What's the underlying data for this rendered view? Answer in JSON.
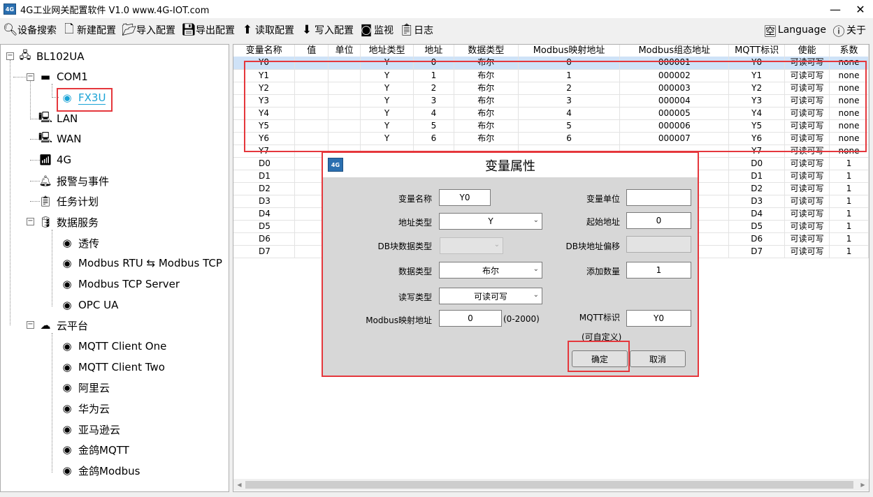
{
  "window": {
    "title": "4G工业网关配置软件 V1.0 www.4G-IOT.com",
    "logo_text": "4G",
    "minimize": "—",
    "close": "✕"
  },
  "toolbar": {
    "search": "设备搜索",
    "new_config": "新建配置",
    "import_config": "导入配置",
    "export_config": "导出配置",
    "read_config": "读取配置",
    "write_config": "写入配置",
    "monitor": "监视",
    "log": "日志",
    "language": "Language",
    "about": "关于"
  },
  "tree": {
    "root": "BL102UA",
    "com1": "COM1",
    "fx3u": "FX3U",
    "lan": "LAN",
    "wan": "WAN",
    "g4": "4G",
    "alarm": "报警与事件",
    "task": "任务计划",
    "data_service": "数据服务",
    "transparent": "透传",
    "rtu_tcp": "Modbus RTU ⇆ Modbus TCP",
    "tcp_server": "Modbus TCP Server",
    "opc_ua": "OPC UA",
    "cloud": "云平台",
    "mqtt_one": "MQTT Client One",
    "mqtt_two": "MQTT Client Two",
    "aliyun": "阿里云",
    "huawei": "华为云",
    "amazon": "亚马逊云",
    "jinge_mqtt": "金鸽MQTT",
    "jinge_modbus": "金鸽Modbus"
  },
  "table": {
    "headers": [
      "变量名称",
      "值",
      "单位",
      "地址类型",
      "地址",
      "数据类型",
      "Modbus映射地址",
      "Modbus组态地址",
      "MQTT标识",
      "使能",
      "系数"
    ],
    "rows": [
      {
        "name": "Y0",
        "value": "",
        "unit": "",
        "addr_type": "Y",
        "addr": "0",
        "dtype": "布尔",
        "map": "0",
        "cfg": "000001",
        "mqtt": "Y0",
        "enable": "可读可写",
        "coef": "none"
      },
      {
        "name": "Y1",
        "value": "",
        "unit": "",
        "addr_type": "Y",
        "addr": "1",
        "dtype": "布尔",
        "map": "1",
        "cfg": "000002",
        "mqtt": "Y1",
        "enable": "可读可写",
        "coef": "none"
      },
      {
        "name": "Y2",
        "value": "",
        "unit": "",
        "addr_type": "Y",
        "addr": "2",
        "dtype": "布尔",
        "map": "2",
        "cfg": "000003",
        "mqtt": "Y2",
        "enable": "可读可写",
        "coef": "none"
      },
      {
        "name": "Y3",
        "value": "",
        "unit": "",
        "addr_type": "Y",
        "addr": "3",
        "dtype": "布尔",
        "map": "3",
        "cfg": "000004",
        "mqtt": "Y3",
        "enable": "可读可写",
        "coef": "none"
      },
      {
        "name": "Y4",
        "value": "",
        "unit": "",
        "addr_type": "Y",
        "addr": "4",
        "dtype": "布尔",
        "map": "4",
        "cfg": "000005",
        "mqtt": "Y4",
        "enable": "可读可写",
        "coef": "none"
      },
      {
        "name": "Y5",
        "value": "",
        "unit": "",
        "addr_type": "Y",
        "addr": "5",
        "dtype": "布尔",
        "map": "5",
        "cfg": "000006",
        "mqtt": "Y5",
        "enable": "可读可写",
        "coef": "none"
      },
      {
        "name": "Y6",
        "value": "",
        "unit": "",
        "addr_type": "Y",
        "addr": "6",
        "dtype": "布尔",
        "map": "6",
        "cfg": "000007",
        "mqtt": "Y6",
        "enable": "可读可写",
        "coef": "none"
      },
      {
        "name": "Y7",
        "value": "",
        "unit": "",
        "addr_type": "",
        "addr": "",
        "dtype": "",
        "map": "",
        "cfg": "",
        "mqtt": "Y7",
        "enable": "可读可写",
        "coef": "none"
      },
      {
        "name": "D0",
        "value": "",
        "unit": "",
        "addr_type": "",
        "addr": "",
        "dtype": "",
        "map": "",
        "cfg": "",
        "mqtt": "D0",
        "enable": "可读可写",
        "coef": "1"
      },
      {
        "name": "D1",
        "value": "",
        "unit": "",
        "addr_type": "",
        "addr": "",
        "dtype": "",
        "map": "",
        "cfg": "",
        "mqtt": "D1",
        "enable": "可读可写",
        "coef": "1"
      },
      {
        "name": "D2",
        "value": "",
        "unit": "",
        "addr_type": "",
        "addr": "",
        "dtype": "",
        "map": "",
        "cfg": "",
        "mqtt": "D2",
        "enable": "可读可写",
        "coef": "1"
      },
      {
        "name": "D3",
        "value": "",
        "unit": "",
        "addr_type": "",
        "addr": "",
        "dtype": "",
        "map": "",
        "cfg": "",
        "mqtt": "D3",
        "enable": "可读可写",
        "coef": "1"
      },
      {
        "name": "D4",
        "value": "",
        "unit": "",
        "addr_type": "",
        "addr": "",
        "dtype": "",
        "map": "",
        "cfg": "",
        "mqtt": "D4",
        "enable": "可读可写",
        "coef": "1"
      },
      {
        "name": "D5",
        "value": "",
        "unit": "",
        "addr_type": "",
        "addr": "",
        "dtype": "",
        "map": "",
        "cfg": "",
        "mqtt": "D5",
        "enable": "可读可写",
        "coef": "1"
      },
      {
        "name": "D6",
        "value": "",
        "unit": "",
        "addr_type": "",
        "addr": "",
        "dtype": "",
        "map": "",
        "cfg": "",
        "mqtt": "D6",
        "enable": "可读可写",
        "coef": "1"
      },
      {
        "name": "D7",
        "value": "",
        "unit": "",
        "addr_type": "",
        "addr": "",
        "dtype": "",
        "map": "",
        "cfg": "",
        "mqtt": "D7",
        "enable": "可读可写",
        "coef": "1"
      }
    ]
  },
  "dialog": {
    "title": "变量属性",
    "logo_text": "4G",
    "var_name_label": "变量名称",
    "var_name": "Y0",
    "var_unit_label": "变量单位",
    "var_unit": "",
    "addr_type_label": "地址类型",
    "addr_type": "Y",
    "start_addr_label": "起始地址",
    "start_addr": "0",
    "db_type_label": "DB块数据类型",
    "db_type": "",
    "db_offset_label": "DB块地址偏移",
    "db_offset": "",
    "data_type_label": "数据类型",
    "data_type": "布尔",
    "add_count_label": "添加数量",
    "add_count": "1",
    "rw_type_label": "读写类型",
    "rw_type": "可读可写",
    "modbus_map_label": "Modbus映射地址",
    "modbus_map": "0",
    "modbus_map_range": "(0-2000)",
    "mqtt_label": "MQTT标识",
    "mqtt": "Y0",
    "mqtt_hint": "(可自定义)",
    "ok": "确定",
    "cancel": "取消"
  },
  "colors": {
    "highlight": "#e5373c",
    "selected_row": "#cfe2f7",
    "selected_tree": "#1aa3d6"
  }
}
